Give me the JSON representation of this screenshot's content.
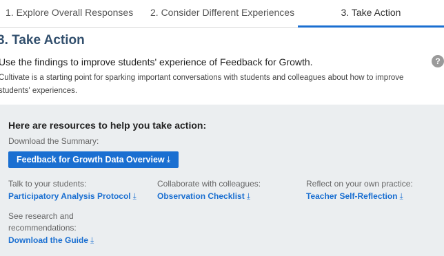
{
  "tabs": [
    {
      "label": "1. Explore Overall Responses",
      "active": false
    },
    {
      "label": "2. Consider Different Experiences",
      "active": false
    },
    {
      "label": "3. Take Action",
      "active": true
    }
  ],
  "page_title": "3. Take Action",
  "lead": "Use the findings to improve students' experience of Feedback for Growth.",
  "description": "Cultivate is a starting point for sparking important conversations with students and colleagues about how to improve students' experiences.",
  "help_icon": "question-icon",
  "resources": {
    "heading": "Here are resources to help you take action:",
    "download_label": "Download the Summary:",
    "download_button": "Feedback for Growth Data Overview",
    "download_arrow": "⤓",
    "columns": [
      {
        "label": "Talk to your students:",
        "link": "Participatory Analysis Protocol"
      },
      {
        "label": "Collaborate with colleagues:",
        "link": "Observation Checklist"
      },
      {
        "label": "Reflect on your own practice:",
        "link": "Teacher Self-Reflection"
      }
    ],
    "guide_label": "See research and recommendations:",
    "guide_link": "Download the Guide"
  },
  "colors": {
    "accent": "#1a6fd1",
    "title": "#33506e",
    "panel_bg": "#ebeef0"
  }
}
